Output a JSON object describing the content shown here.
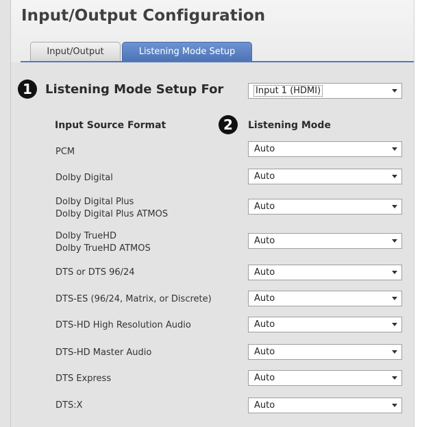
{
  "title": "Input/Output Configuration",
  "tabs": [
    {
      "label": "Input/Output",
      "active": false
    },
    {
      "label": "Listening Mode Setup",
      "active": true
    }
  ],
  "markers": {
    "one": "1",
    "two": "2"
  },
  "setup_for": {
    "label": "Listening Mode Setup For",
    "value": "Input 1 (HDMI)"
  },
  "columns": {
    "source": "Input Source Format",
    "mode": "Listening Mode"
  },
  "rows": [
    {
      "source": [
        "PCM"
      ],
      "mode": "Auto"
    },
    {
      "source": [
        "Dolby Digital"
      ],
      "mode": "Auto"
    },
    {
      "source": [
        "Dolby Digital Plus",
        "Dolby Digital Plus ATMOS"
      ],
      "mode": "Auto"
    },
    {
      "source": [
        "Dolby TrueHD",
        "Dolby TrueHD ATMOS"
      ],
      "mode": "Auto"
    },
    {
      "source": [
        "DTS or DTS 96/24"
      ],
      "mode": "Auto"
    },
    {
      "source": [
        "DTS-ES (96/24, Matrix, or Discrete)"
      ],
      "mode": "Auto"
    },
    {
      "source": [
        "DTS-HD High Resolution Audio"
      ],
      "mode": "Auto"
    },
    {
      "source": [
        "DTS-HD Master Audio"
      ],
      "mode": "Auto"
    },
    {
      "source": [
        "DTS Express"
      ],
      "mode": "Auto"
    },
    {
      "source": [
        "DTS:X"
      ],
      "mode": "Auto"
    }
  ],
  "colors": {
    "tab_active": "#5479b8",
    "background": "#e3e3e3",
    "title": "#3f4042"
  }
}
